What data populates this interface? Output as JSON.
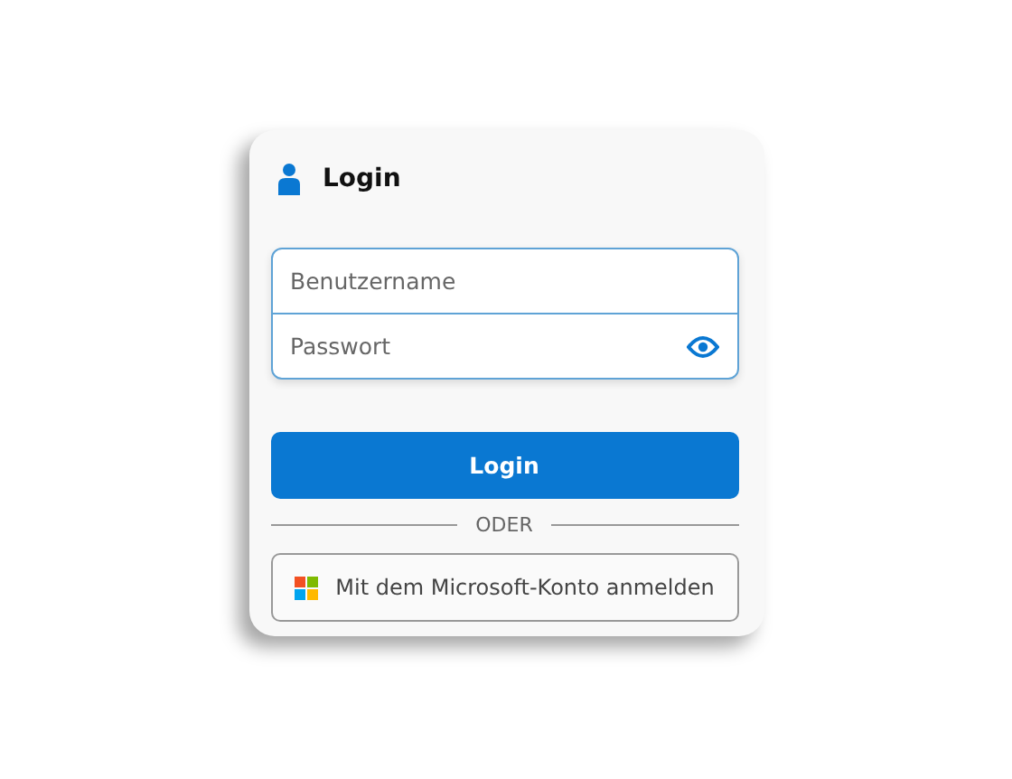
{
  "card": {
    "title": "Login"
  },
  "fields": [
    {
      "placeholder": "Benutzername",
      "kind": "text"
    },
    {
      "placeholder": "Passwort",
      "kind": "password"
    }
  ],
  "login_button": "Login",
  "divider": "ODER",
  "microsoft_button": "Mit dem Microsoft-Konto anmelden"
}
